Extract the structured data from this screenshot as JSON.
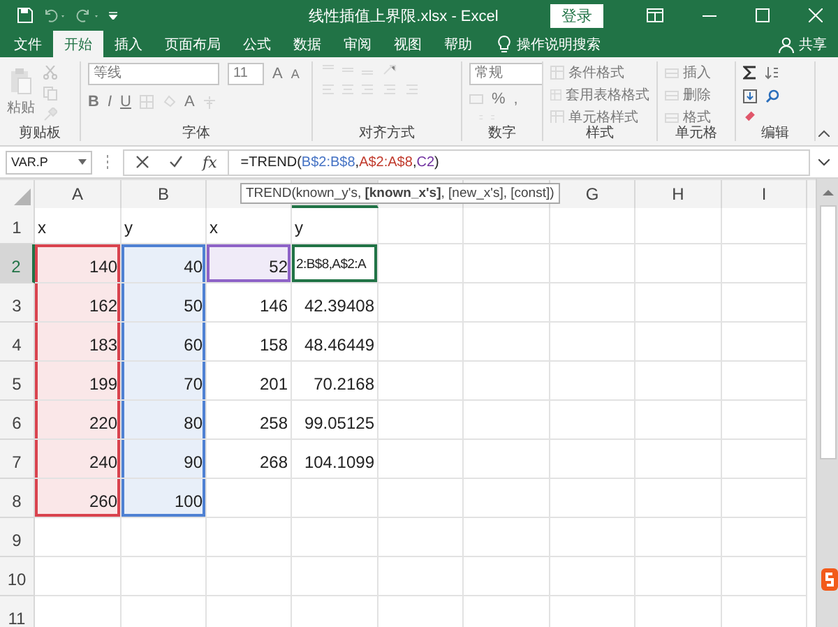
{
  "title_bar": {
    "title": "线性插值上界限.xlsx  -  Excel",
    "sign_in": "登录"
  },
  "tabs": [
    {
      "label": "文件",
      "selected": false
    },
    {
      "label": "开始",
      "selected": true
    },
    {
      "label": "插入",
      "selected": false
    },
    {
      "label": "页面布局",
      "selected": false
    },
    {
      "label": "公式",
      "selected": false
    },
    {
      "label": "数据",
      "selected": false
    },
    {
      "label": "审阅",
      "selected": false
    },
    {
      "label": "视图",
      "selected": false
    },
    {
      "label": "帮助",
      "selected": false
    }
  ],
  "tell_me": "操作说明搜索",
  "share": "共享",
  "ribbon": {
    "clipboard": {
      "label": "剪贴板",
      "paste": "粘贴",
      "disabled": true
    },
    "font": {
      "label": "字体",
      "font_name": "等线",
      "font_size": "11",
      "grow": "A",
      "shrink": "A",
      "bold": "B",
      "italic": "I",
      "underline": "U",
      "font_color": "A",
      "disabled": true
    },
    "alignment": {
      "label": "对齐方式",
      "disabled": true
    },
    "number": {
      "label": "数字",
      "format": "常规",
      "percent": "%",
      "comma": ",",
      "disabled": true
    },
    "styles": {
      "label": "样式",
      "items": [
        "条件格式",
        "套用表格格式",
        "单元格样式"
      ],
      "disabled": true
    },
    "cells": {
      "label": "单元格",
      "items": [
        "插入",
        "删除",
        "格式"
      ],
      "disabled": true
    },
    "editing": {
      "label": "编辑",
      "disabled": false
    }
  },
  "name_box": "VAR.P",
  "formula": {
    "fx": "fx",
    "parts": [
      {
        "text": "=TREND("
      },
      {
        "text": "B$2:B$8",
        "color": "#4472c4"
      },
      {
        "text": ","
      },
      {
        "text": "A$2:A$8",
        "color": "#c0392b"
      },
      {
        "text": ","
      },
      {
        "text": "C2",
        "color": "#7030a0"
      },
      {
        "text": ")"
      }
    ]
  },
  "tooltip": "TREND(known_y's, **[known_x's]**, [new_x's], [const])",
  "sheet": {
    "columns": [
      {
        "label": "A",
        "selected": false
      },
      {
        "label": "B",
        "selected": false
      },
      {
        "selected": false
      },
      {
        "selected": true
      },
      {
        "selected": false
      },
      {
        "selected": false
      },
      {
        "label": "G",
        "selected": false
      },
      {
        "label": "H",
        "selected": false
      },
      {
        "label": "I",
        "selected": false
      }
    ],
    "rows": [
      {
        "header": "1",
        "selected": false,
        "cells": [
          {
            "text": "x",
            "kind": "text"
          },
          {
            "text": "y",
            "kind": "text"
          },
          {
            "text": "x",
            "kind": "text"
          },
          {
            "text": "y",
            "kind": "text"
          }
        ]
      },
      {
        "header": "2",
        "selected": true,
        "cells": [
          {
            "text": "140",
            "kind": "number",
            "color": "#d9434e"
          },
          {
            "text": "40",
            "kind": "number",
            "color": "#4f81d3"
          },
          {
            "text": "52",
            "kind": "number",
            "color": "#8e63c7"
          },
          {
            "text": "2:B$8,A$2:A",
            "kind": "text"
          }
        ]
      },
      {
        "header": "3",
        "selected": false,
        "cells": [
          {
            "text": "162",
            "kind": "number",
            "color": "#d9434e"
          },
          {
            "text": "50",
            "kind": "number",
            "color": "#4f81d3"
          },
          {
            "text": "146",
            "kind": "number"
          },
          {
            "text": "42.39408",
            "kind": "number"
          }
        ]
      },
      {
        "header": "4",
        "selected": false,
        "cells": [
          {
            "text": "183",
            "kind": "number",
            "color": "#d9434e"
          },
          {
            "text": "60",
            "kind": "number",
            "color": "#4f81d3"
          },
          {
            "text": "158",
            "kind": "number"
          },
          {
            "text": "48.46449",
            "kind": "number"
          }
        ]
      },
      {
        "header": "5",
        "selected": false,
        "cells": [
          {
            "text": "199",
            "kind": "number",
            "color": "#d9434e"
          },
          {
            "text": "70",
            "kind": "number",
            "color": "#4f81d3"
          },
          {
            "text": "201",
            "kind": "number"
          },
          {
            "text": "70.2168",
            "kind": "number"
          }
        ]
      },
      {
        "header": "6",
        "selected": false,
        "cells": [
          {
            "text": "220",
            "kind": "number",
            "color": "#d9434e"
          },
          {
            "text": "80",
            "kind": "number",
            "color": "#4f81d3"
          },
          {
            "text": "258",
            "kind": "number"
          },
          {
            "text": "99.05125",
            "kind": "number"
          }
        ]
      },
      {
        "header": "7",
        "selected": false,
        "cells": [
          {
            "text": "240",
            "kind": "number",
            "color": "#d9434e"
          },
          {
            "text": "90",
            "kind": "number",
            "color": "#4f81d3"
          },
          {
            "text": "268",
            "kind": "number"
          },
          {
            "text": "104.1099",
            "kind": "number"
          }
        ]
      },
      {
        "header": "8",
        "selected": false,
        "cells": [
          {
            "text": "260",
            "kind": "number",
            "color": "#d9434e"
          },
          {
            "text": "100",
            "kind": "number",
            "color": "#4f81d3"
          }
        ]
      },
      {
        "header": "9",
        "selected": false
      },
      {
        "header": "10",
        "selected": false
      },
      {
        "header": "11",
        "selected": false
      }
    ]
  }
}
